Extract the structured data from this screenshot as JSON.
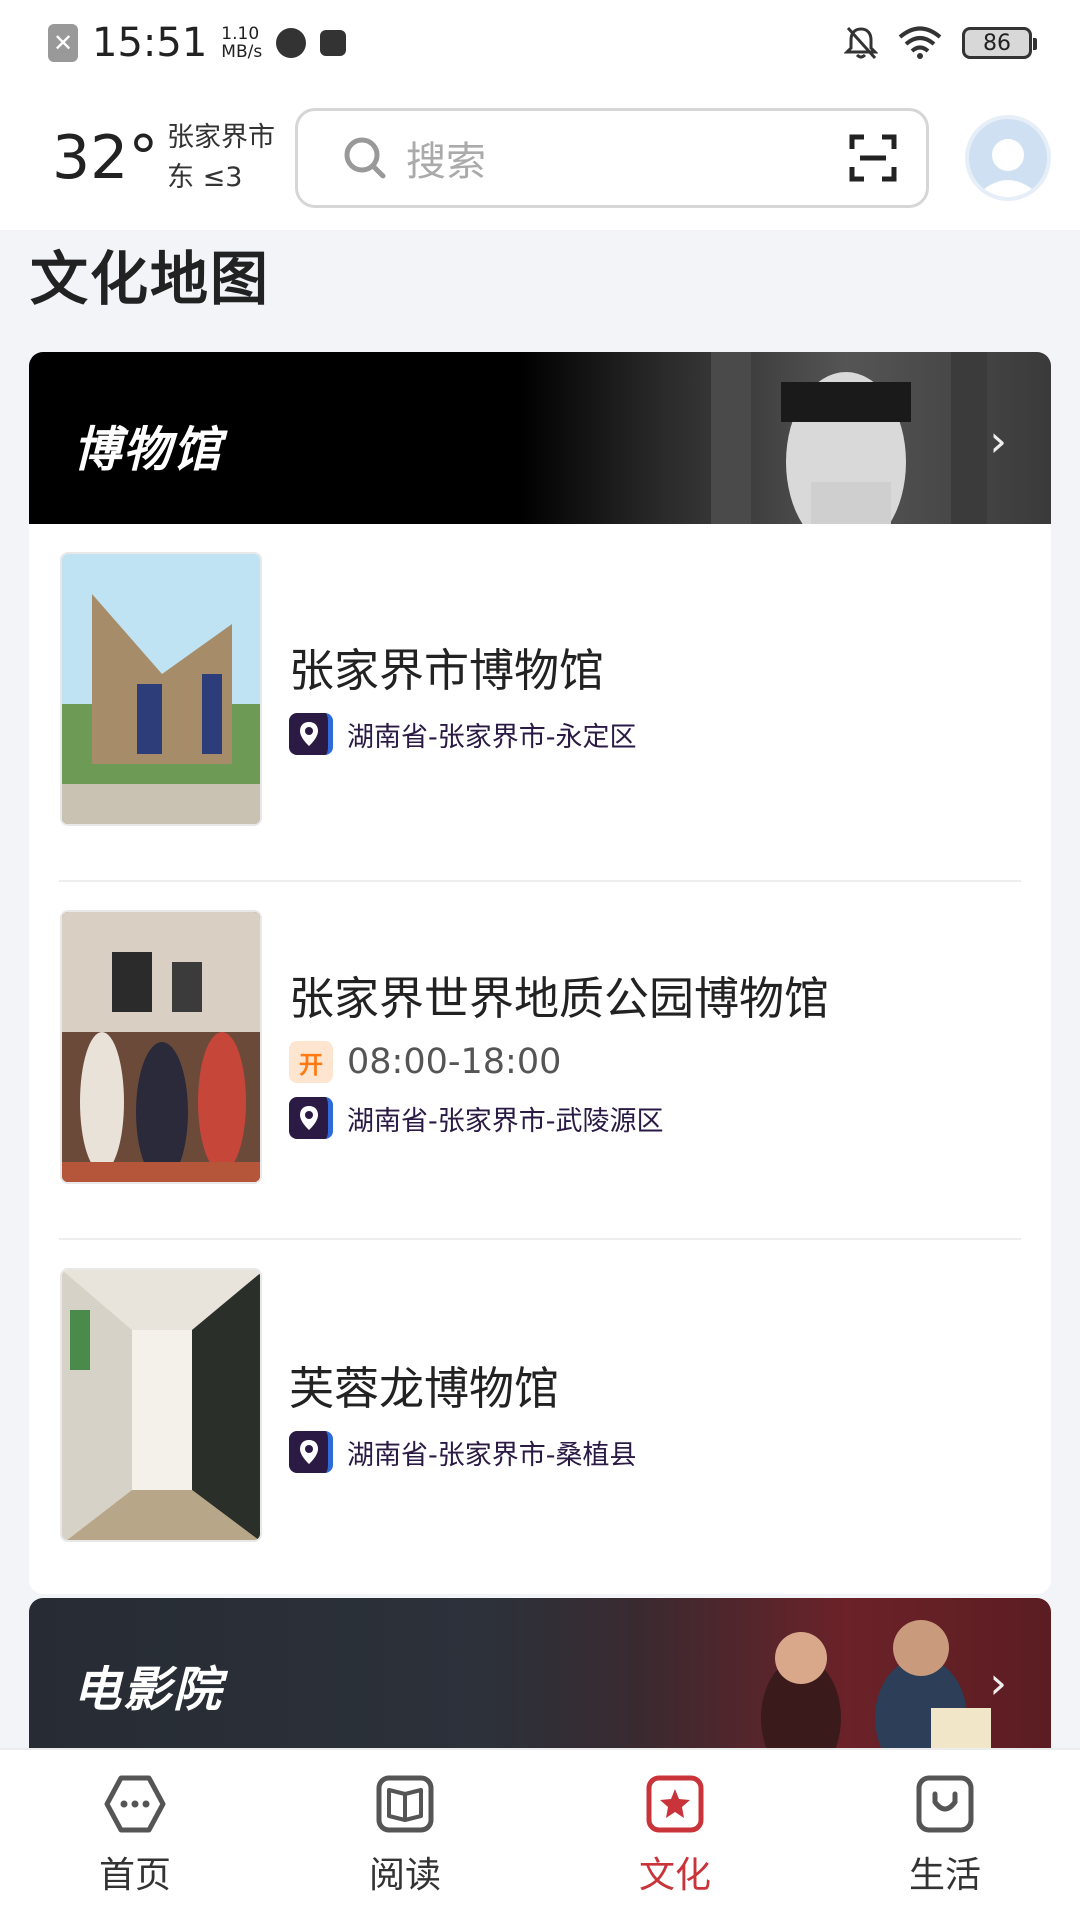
{
  "status_bar": {
    "time": "15:51",
    "speed_value": "1.10",
    "speed_unit": "MB/s",
    "battery": "86"
  },
  "header": {
    "temperature": "32°",
    "city": "张家界市",
    "wind": "东 ≤3",
    "search_placeholder": "搜索"
  },
  "page_title": "文化地图",
  "museum_section": {
    "title": "博物馆",
    "items": [
      {
        "name": "张家界市博物馆",
        "location": "湖南省-张家界市-永定区"
      },
      {
        "name": "张家界世界地质公园博物馆",
        "open_badge": "开",
        "hours": "08:00-18:00",
        "location": "湖南省-张家界市-武陵源区"
      },
      {
        "name": "芙蓉龙博物馆",
        "location": "湖南省-张家界市-桑植县"
      }
    ]
  },
  "cinema_section": {
    "title": "电影院"
  },
  "tabs": [
    {
      "label": "首页",
      "icon": "home-hexagon-icon",
      "active": false
    },
    {
      "label": "阅读",
      "icon": "book-icon",
      "active": false
    },
    {
      "label": "文化",
      "icon": "star-badge-icon",
      "active": true
    },
    {
      "label": "生活",
      "icon": "bag-smile-icon",
      "active": false
    }
  ],
  "colors": {
    "accent_active": "#c8343a",
    "location_icon_bg": "#2a1a44",
    "open_icon_fg": "#ff7a12"
  }
}
